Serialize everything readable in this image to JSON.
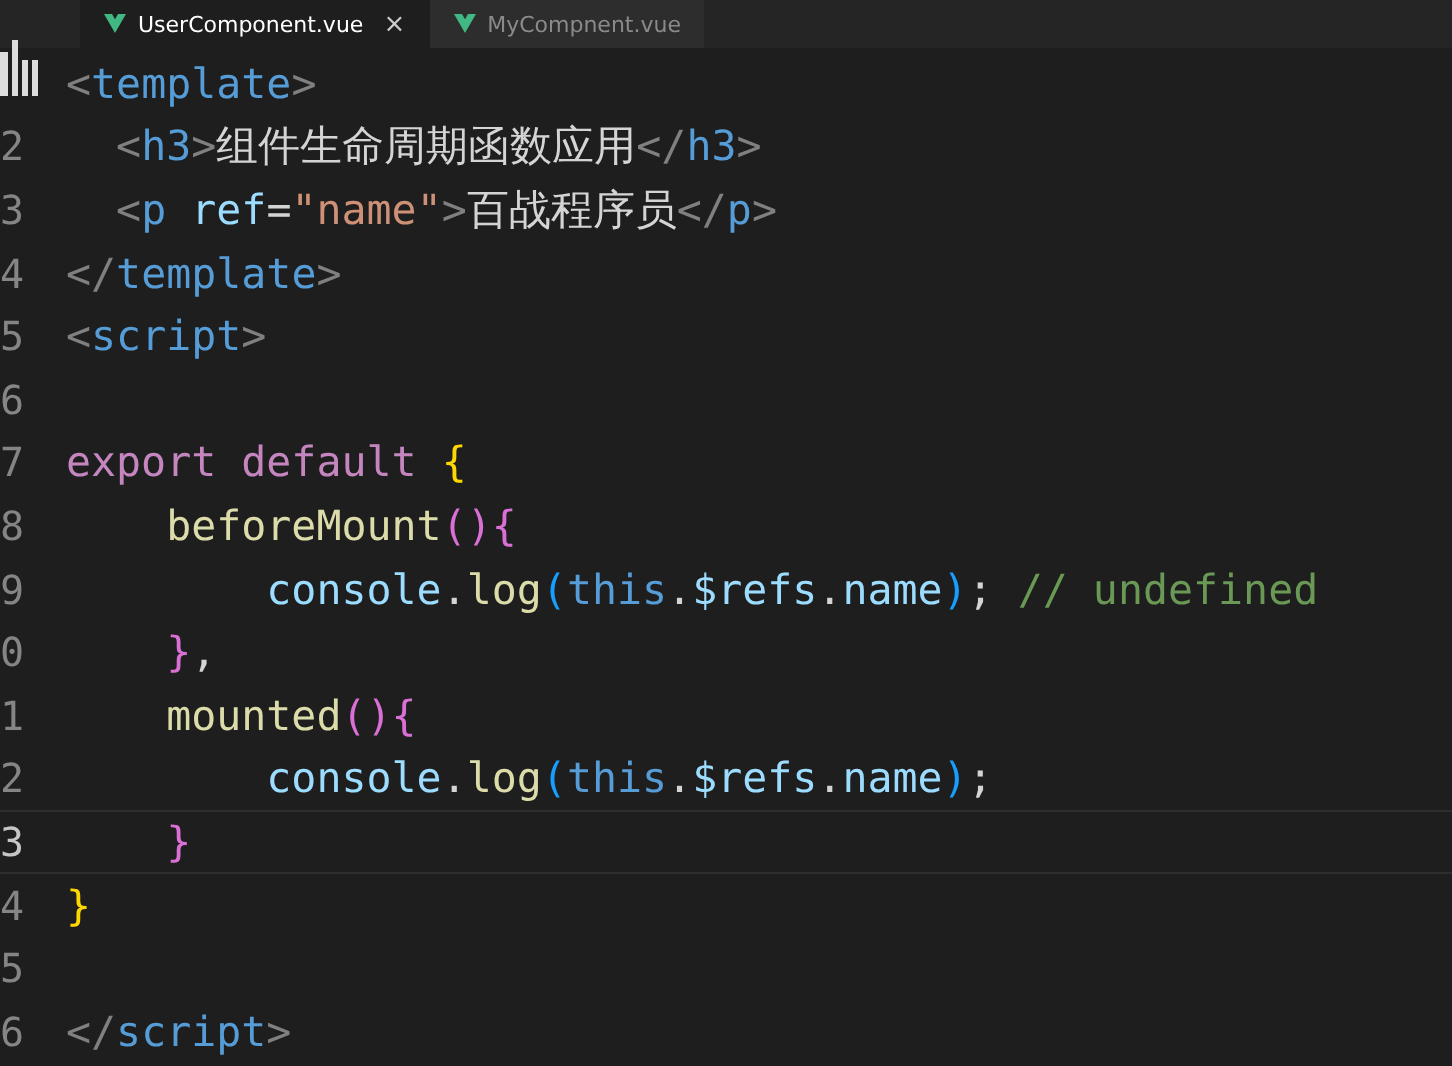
{
  "tabs": [
    {
      "label": "UserComponent.vue",
      "selected": true,
      "close": "×"
    },
    {
      "label": "MyCompnent.vue",
      "selected": false
    }
  ],
  "editor": {
    "lines": [
      {
        "selected": false,
        "tokens": [
          {
            "kind": "punct",
            "text": "<"
          },
          {
            "kind": "tag",
            "text": "template"
          },
          {
            "kind": "punct",
            "text": ">"
          }
        ]
      },
      {
        "number": "2",
        "selected": false,
        "tokens": [
          {
            "kind": "punct",
            "text": "  <"
          },
          {
            "kind": "tag",
            "text": "h3"
          },
          {
            "kind": "punct",
            "text": ">"
          },
          {
            "kind": "text",
            "text": "组件生命周期函数应用"
          },
          {
            "kind": "punct",
            "text": "</"
          },
          {
            "kind": "tag",
            "text": "h3"
          },
          {
            "kind": "punct",
            "text": ">"
          }
        ]
      },
      {
        "number": "3",
        "selected": false,
        "tokens": [
          {
            "kind": "punct",
            "text": "  <"
          },
          {
            "kind": "tag",
            "text": "p"
          },
          {
            "kind": "attr",
            "text": " ref"
          },
          {
            "kind": "text",
            "text": "="
          },
          {
            "kind": "string",
            "text": "\"name\""
          },
          {
            "kind": "punct",
            "text": ">"
          },
          {
            "kind": "text",
            "text": "百战程序员"
          },
          {
            "kind": "punct",
            "text": "</"
          },
          {
            "kind": "tag",
            "text": "p"
          },
          {
            "kind": "punct",
            "text": ">"
          }
        ]
      },
      {
        "number": "4",
        "selected": false,
        "tokens": [
          {
            "kind": "punct",
            "text": "</"
          },
          {
            "kind": "tag",
            "text": "template"
          },
          {
            "kind": "punct",
            "text": ">"
          }
        ]
      },
      {
        "number": "5",
        "selected": false,
        "tokens": [
          {
            "kind": "punct",
            "text": "<"
          },
          {
            "kind": "tag",
            "text": "script"
          },
          {
            "kind": "punct",
            "text": ">"
          }
        ]
      },
      {
        "number": "6",
        "selected": false
      },
      {
        "number": "7",
        "selected": false,
        "tokens": [
          {
            "kind": "keyword",
            "text": "export default "
          },
          {
            "kind": "brace1",
            "text": "{"
          }
        ]
      },
      {
        "number": "8",
        "selected": false,
        "tokens": [
          {
            "kind": "func",
            "text": "    beforeMount"
          },
          {
            "kind": "brace2",
            "text": "(){"
          }
        ]
      },
      {
        "number": "9",
        "selected": false,
        "tokens": [
          {
            "kind": "var",
            "text": "        console"
          },
          {
            "kind": "text",
            "text": "."
          },
          {
            "kind": "func",
            "text": "log"
          },
          {
            "kind": "brace3",
            "text": "("
          },
          {
            "kind": "this",
            "text": "this"
          },
          {
            "kind": "text",
            "text": "."
          },
          {
            "kind": "var",
            "text": "$refs"
          },
          {
            "kind": "text",
            "text": "."
          },
          {
            "kind": "var",
            "text": "name"
          },
          {
            "kind": "brace3",
            "text": ")"
          },
          {
            "kind": "text",
            "text": "; "
          },
          {
            "kind": "comment",
            "text": "// undefined"
          }
        ]
      },
      {
        "number": "0",
        "selected": false,
        "tokens": [
          {
            "kind": "brace2",
            "text": "    }"
          },
          {
            "kind": "text",
            "text": ","
          }
        ]
      },
      {
        "number": "1",
        "selected": false,
        "tokens": [
          {
            "kind": "func",
            "text": "    mounted"
          },
          {
            "kind": "brace2",
            "text": "(){"
          }
        ]
      },
      {
        "number": "2",
        "selected": false,
        "tokens": [
          {
            "kind": "var",
            "text": "        console"
          },
          {
            "kind": "text",
            "text": "."
          },
          {
            "kind": "func",
            "text": "log"
          },
          {
            "kind": "brace3",
            "text": "("
          },
          {
            "kind": "this",
            "text": "this"
          },
          {
            "kind": "text",
            "text": "."
          },
          {
            "kind": "var",
            "text": "$refs"
          },
          {
            "kind": "text",
            "text": "."
          },
          {
            "kind": "var",
            "text": "name"
          },
          {
            "kind": "brace3",
            "text": ")"
          },
          {
            "kind": "text",
            "text": ";"
          }
        ]
      },
      {
        "number": "3",
        "selected": true,
        "tokens": [
          {
            "kind": "brace2",
            "text": "    }"
          }
        ]
      },
      {
        "number": "4",
        "selected": false,
        "tokens": [
          {
            "kind": "brace1",
            "text": "}"
          }
        ]
      },
      {
        "number": "5",
        "selected": false
      },
      {
        "number": "6",
        "selected": false,
        "tokens": [
          {
            "kind": "punct",
            "text": "</"
          },
          {
            "kind": "tag",
            "text": "script"
          },
          {
            "kind": "punct",
            "text": ">"
          }
        ]
      }
    ]
  }
}
